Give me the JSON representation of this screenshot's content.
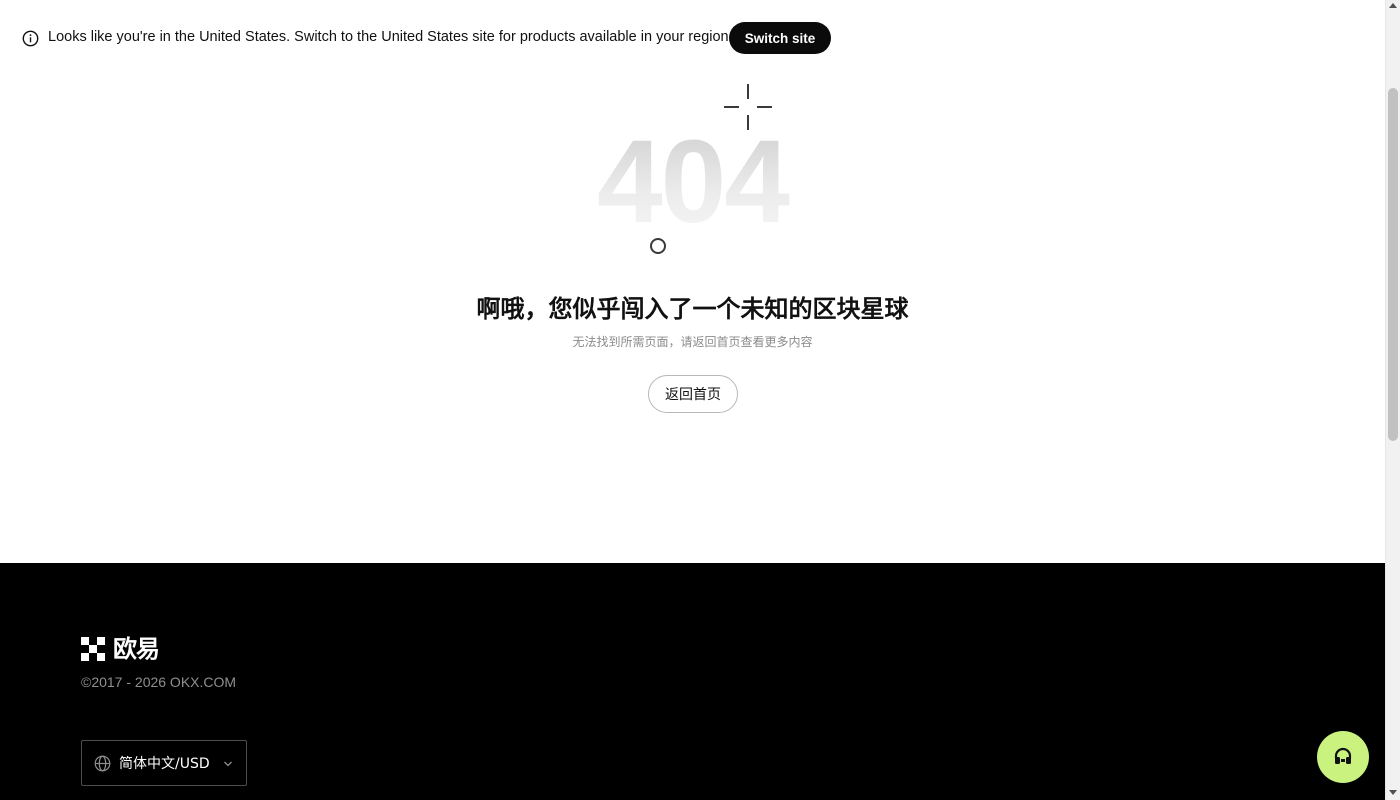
{
  "banner": {
    "icon": "info-circle-icon",
    "message": "Looks like you're in the United States. Switch to the United States site for products available in your region.",
    "switch_label": "Switch site"
  },
  "error": {
    "code": "404",
    "title": "啊哦，您似乎闯入了一个未知的区块星球",
    "subtitle": "无法找到所需页面，请返回首页查看更多内容",
    "home_label": "返回首页"
  },
  "footer": {
    "logo_text": "欧易",
    "copyright": "©2017 - 2026 OKX.COM",
    "language": "简体中文/USD",
    "language_icon": "globe-icon"
  },
  "support": {
    "icon": "headset-icon"
  },
  "colors": {
    "accent": "#c9f27e",
    "footer_bg": "#000000",
    "button_dark": "#0b0b0b"
  }
}
